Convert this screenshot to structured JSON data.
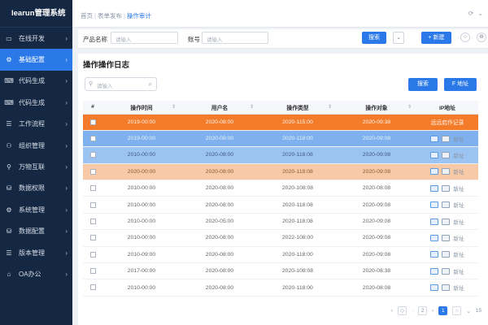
{
  "app": {
    "title": "learun管理系统"
  },
  "sidebar": {
    "items": [
      {
        "label": "在线开发",
        "active": false
      },
      {
        "label": "基础配置",
        "active": true
      },
      {
        "label": "代码生成",
        "active": false
      },
      {
        "label": "代码生成",
        "active": false
      },
      {
        "label": "工作流程",
        "active": false
      },
      {
        "label": "组织管理",
        "active": false
      },
      {
        "label": "万物互联",
        "active": false
      },
      {
        "label": "数据权限",
        "active": false
      },
      {
        "label": "系统管理",
        "active": false
      },
      {
        "label": "数据配置",
        "active": false
      },
      {
        "label": "版本管理",
        "active": false
      },
      {
        "label": "OA办公",
        "active": false
      }
    ]
  },
  "breadcrumb": {
    "items": [
      "首页",
      "表单发布"
    ],
    "current": "操作审计"
  },
  "filter": {
    "product_label": "产品名称",
    "product_placeholder": "请输入",
    "account_label": "账号",
    "account_placeholder": "请输入",
    "search_button": "搜索",
    "add_button": "+ 新建"
  },
  "panel": {
    "title": "操作操作日志",
    "search_placeholder": "请输入",
    "search_button": "搜索",
    "address_button": "F 地址"
  },
  "table": {
    "columns": [
      "操作时间",
      "用户名",
      "操作类型",
      "操作对象",
      "IP地址"
    ],
    "index_header": "#",
    "rows": [
      {
        "time": "2019-00:00",
        "user": "2020-08:00",
        "type": "2020-115:00",
        "target": "2020-09:38",
        "ip": "远远启作记录",
        "style": "orange"
      },
      {
        "time": "2019-00:00",
        "user": "2020-08:00",
        "type": "2020-118:00",
        "target": "2020-09:08",
        "ip": "新址",
        "style": "blue1"
      },
      {
        "time": "2010-00:00",
        "user": "2020-08:00",
        "type": "2020-118:08",
        "target": "2020-09:08",
        "ip": "新址",
        "style": "blue2"
      },
      {
        "time": "2020-00:00",
        "user": "2020-08:00",
        "type": "2020-118:08",
        "target": "2020-09:08",
        "ip": "新址",
        "style": "peach"
      },
      {
        "time": "2010-00:00",
        "user": "2020-08:00",
        "type": "2020-108:08",
        "target": "2020-08:08",
        "ip": "新址",
        "style": ""
      },
      {
        "time": "2010-00:00",
        "user": "2020-08:00",
        "type": "2020-118:08",
        "target": "2020-09:08",
        "ip": "新址",
        "style": ""
      },
      {
        "time": "2010-00:00",
        "user": "2020-05:00",
        "type": "2020-118:08",
        "target": "2020-09:08",
        "ip": "新址",
        "style": ""
      },
      {
        "time": "2010-00:00",
        "user": "2020-08:00",
        "type": "2022-108:00",
        "target": "2020-09:08",
        "ip": "新址",
        "style": ""
      },
      {
        "time": "2010-09:00",
        "user": "2020-08:00",
        "type": "2020-118:00",
        "target": "2020-09:08",
        "ip": "新址",
        "style": ""
      },
      {
        "time": "2017-00:00",
        "user": "2020-08:00",
        "type": "2020-108:08",
        "target": "2020-08:38",
        "ip": "新址",
        "style": ""
      },
      {
        "time": "2010-00:00",
        "user": "2020-08:00",
        "type": "2020-118:00",
        "target": "2020-08:08",
        "ip": "新址",
        "style": ""
      }
    ]
  },
  "pagination": {
    "pages": [
      "1",
      "2"
    ],
    "current": "1",
    "size": "15"
  }
}
